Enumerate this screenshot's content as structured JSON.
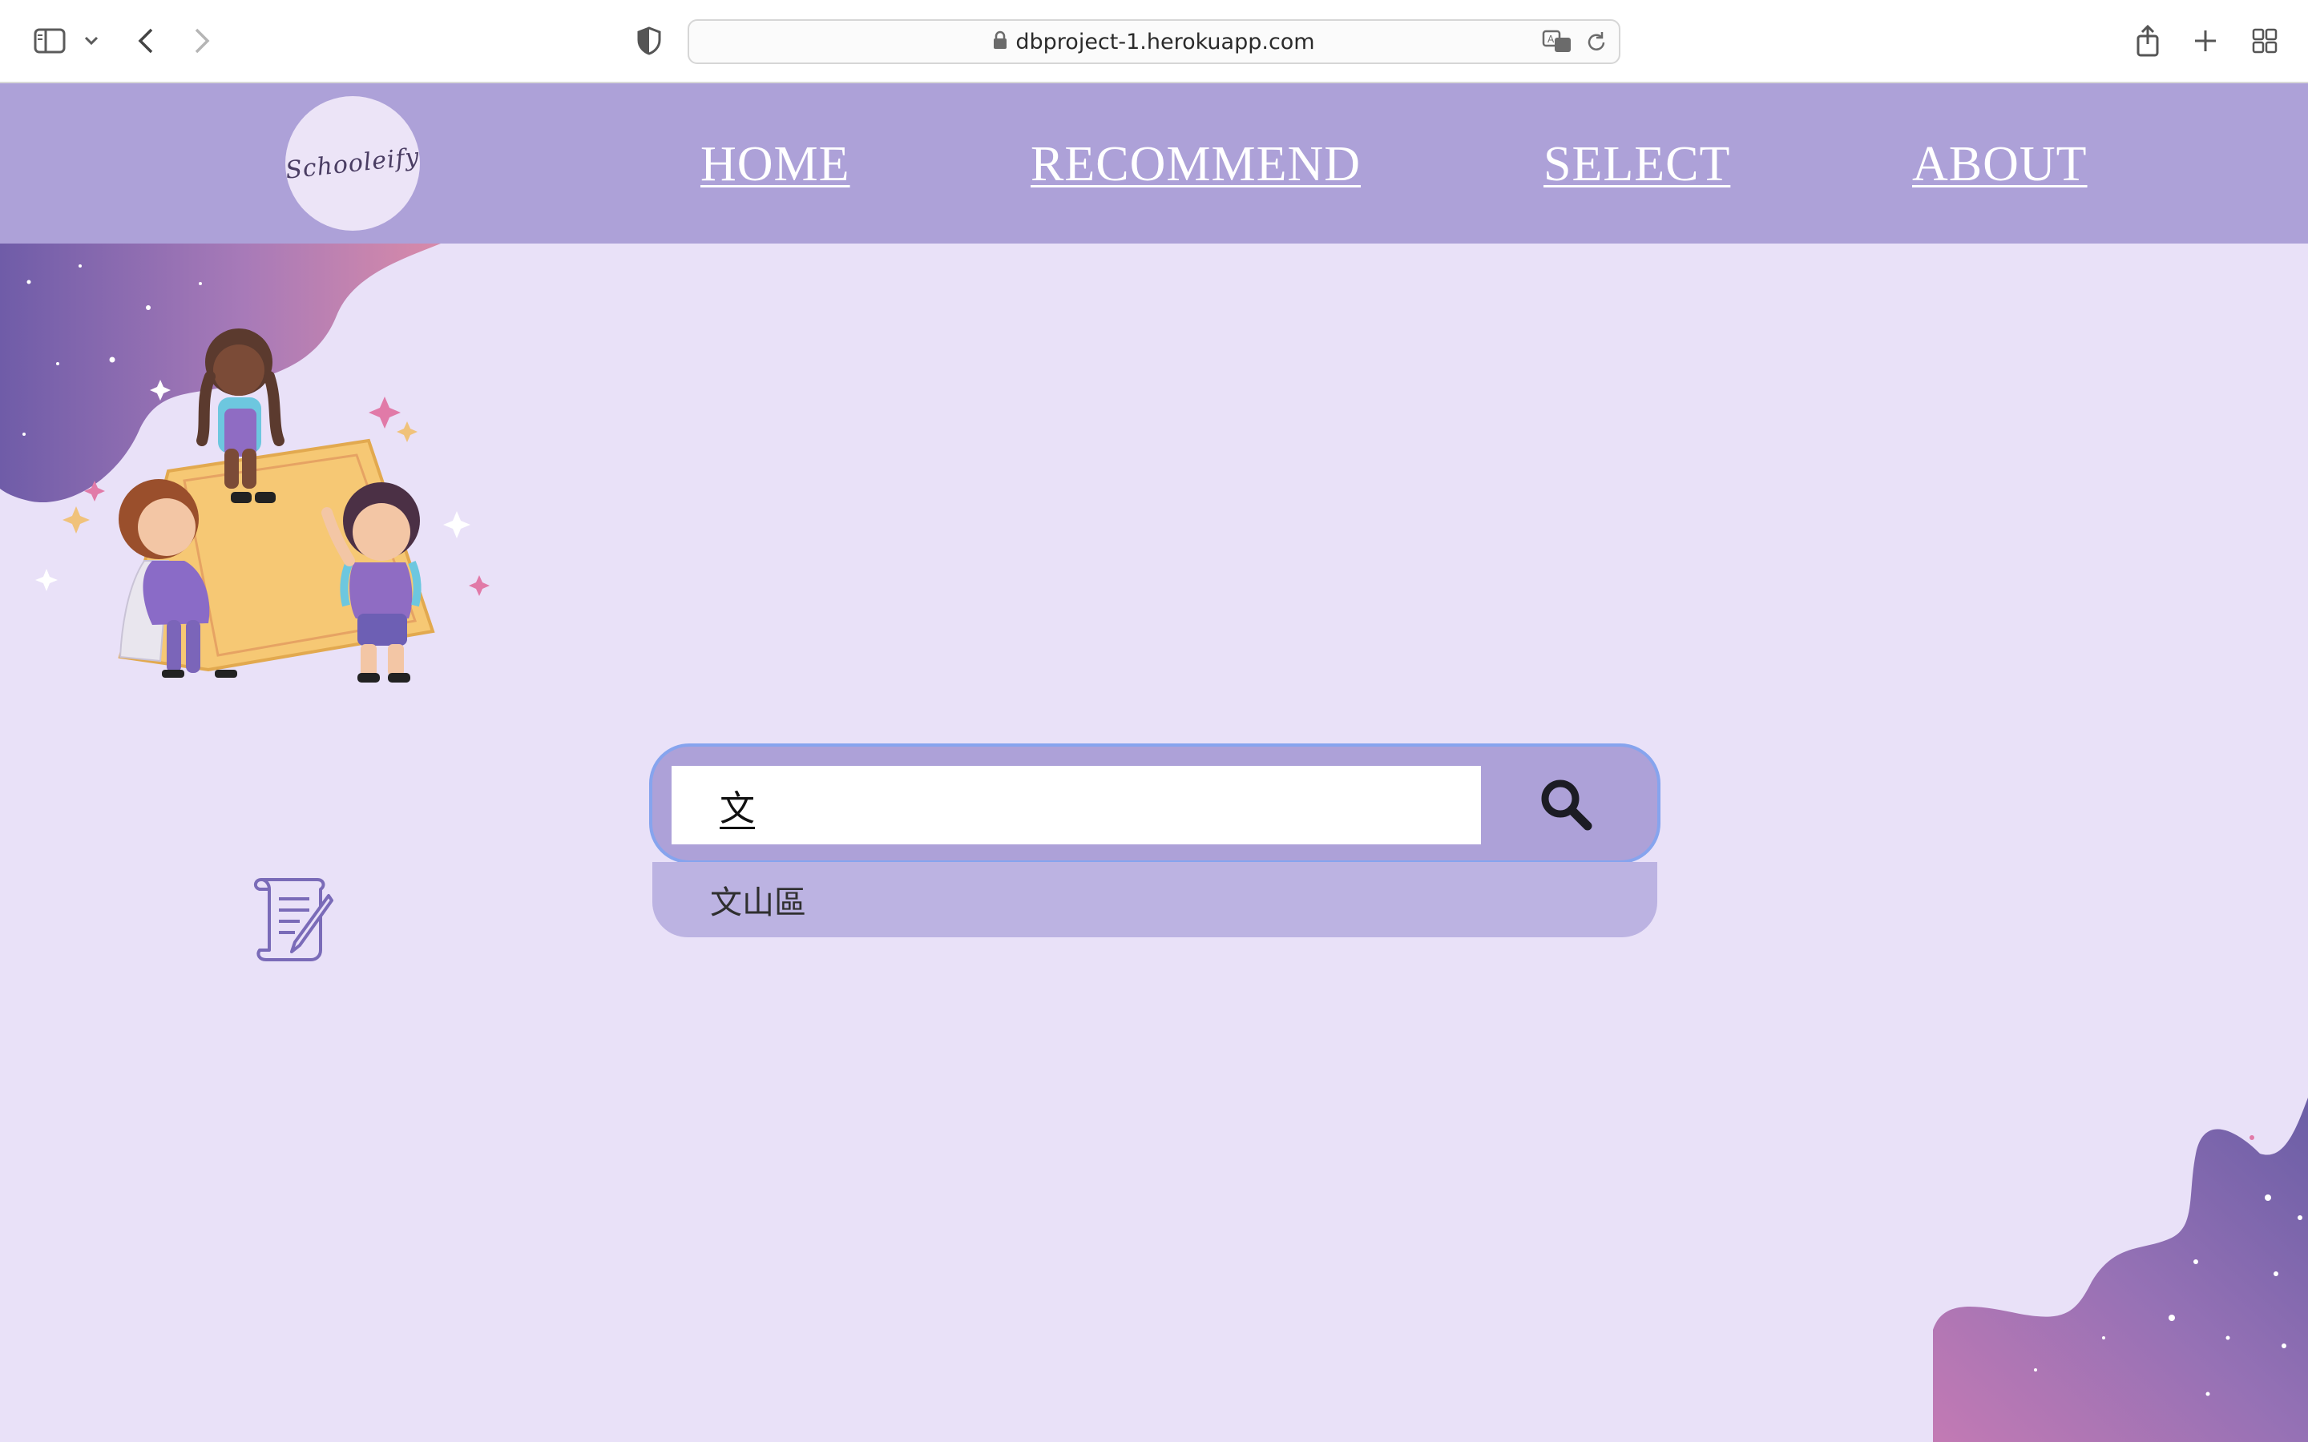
{
  "browser": {
    "url": "dbproject-1.herokuapp.com",
    "icons": [
      "sidebar-icon",
      "chevron-down-icon",
      "back-icon",
      "forward-icon",
      "shield-icon",
      "lock-icon",
      "translate-icon",
      "reload-icon",
      "share-icon",
      "plus-icon",
      "tabs-grid-icon"
    ]
  },
  "header": {
    "logo_text": "Schooleify",
    "nav": [
      {
        "label": "HOME"
      },
      {
        "label": "RECOMMEND"
      },
      {
        "label": "SELECT"
      },
      {
        "label": "ABOUT"
      }
    ]
  },
  "search": {
    "value": "文",
    "suggestions": [
      "文山區"
    ],
    "button_icon": "search-icon"
  },
  "colors": {
    "header_bg": "#ada1d8",
    "page_bg": "#e9e1f8",
    "suggestion_bg": "#bcb3e2",
    "focus_ring": "#86a4ee"
  }
}
